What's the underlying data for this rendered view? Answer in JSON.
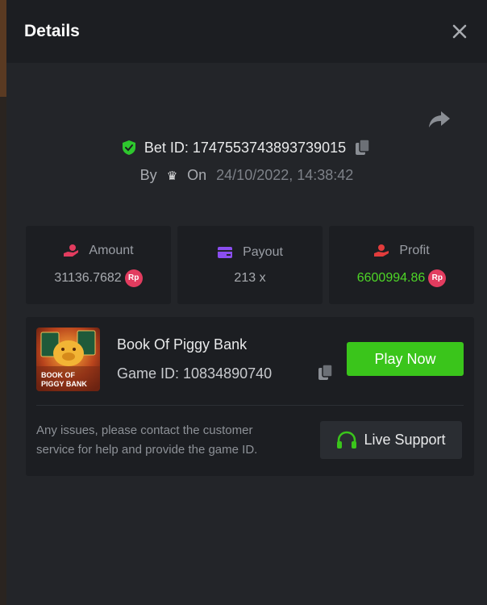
{
  "header": {
    "title": "Details"
  },
  "bet": {
    "id_label": "Bet ID: 1747553743893739015",
    "by_label": "By",
    "on_label": "On",
    "date": "24/10/2022, 14:38:42"
  },
  "stats": [
    {
      "label": "Amount",
      "value": "31136.7682",
      "currency": "Rp",
      "icon": "hand-coins-icon",
      "icon_color": "#e23c5f"
    },
    {
      "label": "Payout",
      "value": "213 x",
      "icon": "wallet-card-icon",
      "icon_color": "#8b4ef0"
    },
    {
      "label": "Profit",
      "value": "6600994.86",
      "currency": "Rp",
      "icon": "hand-money-icon",
      "icon_color": "#e23c3c",
      "value_color": "#4ed627"
    }
  ],
  "game": {
    "name": "Book Of Piggy Bank",
    "id_label": "Game ID: 10834890740",
    "thumb_text_line1": "BOOK OF",
    "thumb_text_line2": "PIGGY BANK",
    "play_label": "Play Now"
  },
  "support": {
    "help_text": "Any issues, please contact the customer service for help and provide the game ID.",
    "button_label": "Live Support"
  },
  "colors": {
    "accent_green": "#3ac51b",
    "profit_green": "#4ed627",
    "rp_badge": "#e23c5f",
    "shield_green": "#2ec72e"
  }
}
